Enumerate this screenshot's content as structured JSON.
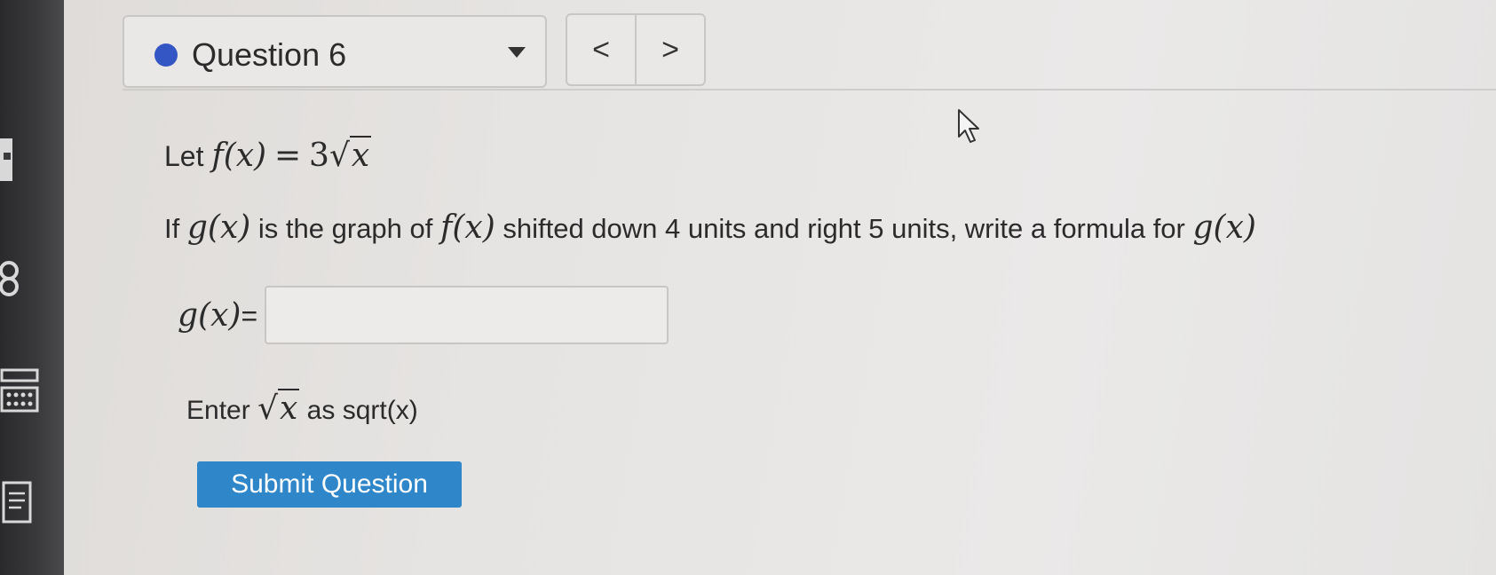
{
  "header": {
    "question_label": "Question 6",
    "prev_label": "<",
    "next_label": ">"
  },
  "question": {
    "let_prefix": "Let",
    "f_def_lhs": "f(x)",
    "f_def_eq": "=",
    "f_def_coef": "3",
    "f_def_radicand": "x",
    "if_prefix": "If",
    "g_expr": "g(x)",
    "mid_text": "is the graph of",
    "f_expr": "f(x)",
    "rest_text": "shifted down 4 units and right 5 units, write a formula for",
    "g_expr_end": "g(x)"
  },
  "answer": {
    "label_func": "g(x)",
    "label_eq": "=",
    "value": "",
    "placeholder": ""
  },
  "hint": {
    "prefix": "Enter",
    "radicand": "x",
    "suffix": "as sqrt(x)"
  },
  "submit": {
    "label": "Submit Question"
  },
  "colors": {
    "status_dot": "#3456c4",
    "submit_bg": "#2f86c9"
  }
}
